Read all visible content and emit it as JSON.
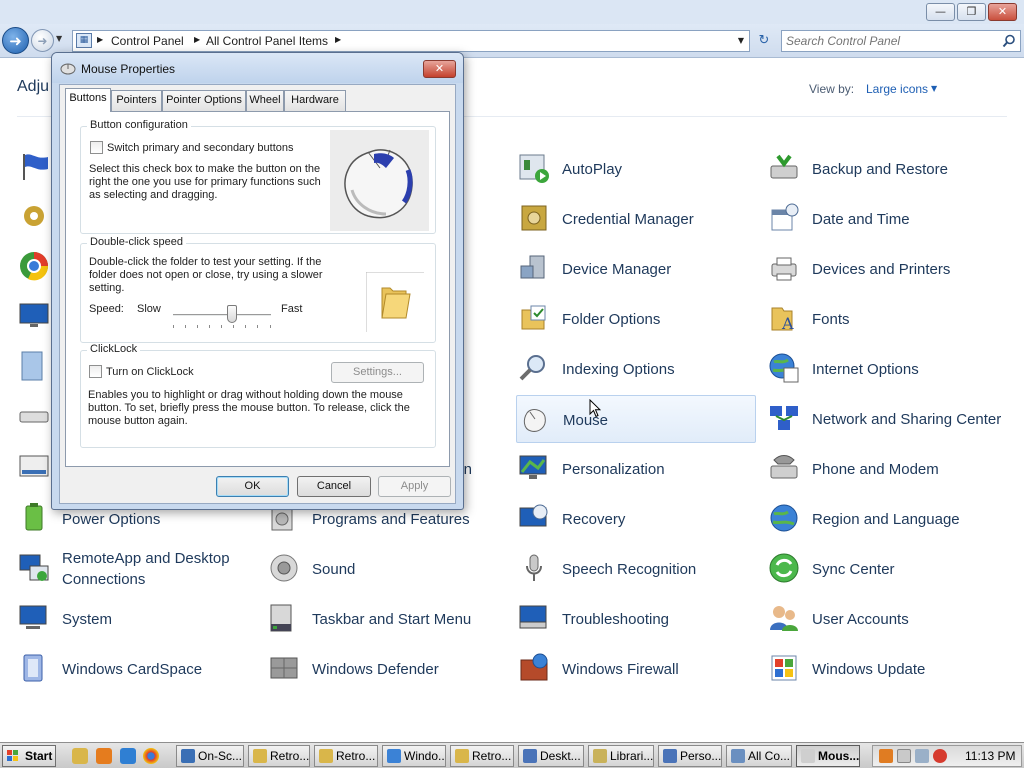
{
  "window": {
    "minimize_icon": "minimize-icon",
    "maximize_icon": "restore-icon",
    "close_icon": "close-icon"
  },
  "nav": {
    "breadcrumb": [
      "Control Panel",
      "All Control Panel Items"
    ],
    "search_placeholder": "Search Control Panel"
  },
  "content": {
    "heading": "Adju",
    "view_by_label": "View by:",
    "view_by_value": "Large icons"
  },
  "items": [
    {
      "label": "AutoPlay",
      "icon": "autoplay-icon"
    },
    {
      "label": "Backup and Restore",
      "icon": "backup-icon"
    },
    {
      "label": "Credential Manager",
      "icon": "safe-icon"
    },
    {
      "label": "Date and Time",
      "icon": "calendar-clock-icon"
    },
    {
      "label": "Device Manager",
      "icon": "device-manager-icon"
    },
    {
      "label": "Devices and Printers",
      "icon": "printer-icon"
    },
    {
      "label": "Folder Options",
      "icon": "folder-icon"
    },
    {
      "label": "Fonts",
      "icon": "fonts-icon"
    },
    {
      "label": "Indexing Options",
      "icon": "magnifier-icon"
    },
    {
      "label": "Internet Options",
      "icon": "globe-icon"
    },
    {
      "label": "Mouse",
      "icon": "mouse-icon"
    },
    {
      "label": "Network and Sharing Center",
      "icon": "network-icon"
    },
    {
      "label": "ion",
      "icon": ""
    },
    {
      "label": "Personalization",
      "icon": "personalization-icon"
    },
    {
      "label": "Phone and Modem",
      "icon": "phone-icon"
    },
    {
      "label": "Power Options",
      "icon": "battery-icon"
    },
    {
      "label": "Programs and Features",
      "icon": "programs-icon"
    },
    {
      "label": "Recovery",
      "icon": "recovery-icon"
    },
    {
      "label": "Region and Language",
      "icon": "globe-clock-icon"
    },
    {
      "label": "RemoteApp and Desktop Connections",
      "icon": "remote-desktop-icon"
    },
    {
      "label": "Sound",
      "icon": "speaker-icon"
    },
    {
      "label": "Speech Recognition",
      "icon": "microphone-icon"
    },
    {
      "label": "Sync Center",
      "icon": "sync-icon"
    },
    {
      "label": "System",
      "icon": "computer-icon"
    },
    {
      "label": "Taskbar and Start Menu",
      "icon": "taskbar-icon"
    },
    {
      "label": "Troubleshooting",
      "icon": "troubleshoot-icon"
    },
    {
      "label": "User Accounts",
      "icon": "users-icon"
    },
    {
      "label": "Windows CardSpace",
      "icon": "cardspace-icon"
    },
    {
      "label": "Windows Defender",
      "icon": "defender-icon"
    },
    {
      "label": "Windows Firewall",
      "icon": "firewall-icon"
    },
    {
      "label": "Windows Update",
      "icon": "update-icon"
    }
  ],
  "dialog": {
    "title": "Mouse Properties",
    "tabs": [
      "Buttons",
      "Pointers",
      "Pointer Options",
      "Wheel",
      "Hardware"
    ],
    "active_tab": "Buttons",
    "button_config": {
      "title": "Button configuration",
      "checkbox_label": "Switch primary and secondary buttons",
      "checked": false,
      "description": "Select this check box to make the button on the right the one you use for primary functions such as selecting and dragging."
    },
    "double_click": {
      "title": "Double-click speed",
      "description": "Double-click the folder to test your setting. If the folder does not open or close, try using a slower setting.",
      "speed_label": "Speed:",
      "slow_label": "Slow",
      "fast_label": "Fast",
      "speed_fraction": 0.6
    },
    "clicklock": {
      "title": "ClickLock",
      "checkbox_label": "Turn on ClickLock",
      "checked": false,
      "settings_button": "Settings...",
      "description": "Enables you to highlight or drag without holding down the mouse button. To set, briefly press the mouse button. To release, click the mouse button again."
    },
    "buttons": {
      "ok": "OK",
      "cancel": "Cancel",
      "apply": "Apply"
    }
  },
  "taskbar": {
    "start_label": "Start",
    "buttons": [
      "On-Sc...",
      "Retro...",
      "Retro...",
      "Windo...",
      "Retro...",
      "Deskt...",
      "Librari...",
      "Perso...",
      "All Co...",
      "Mous..."
    ],
    "active_button": "Mous...",
    "clock": "11:13 PM"
  }
}
